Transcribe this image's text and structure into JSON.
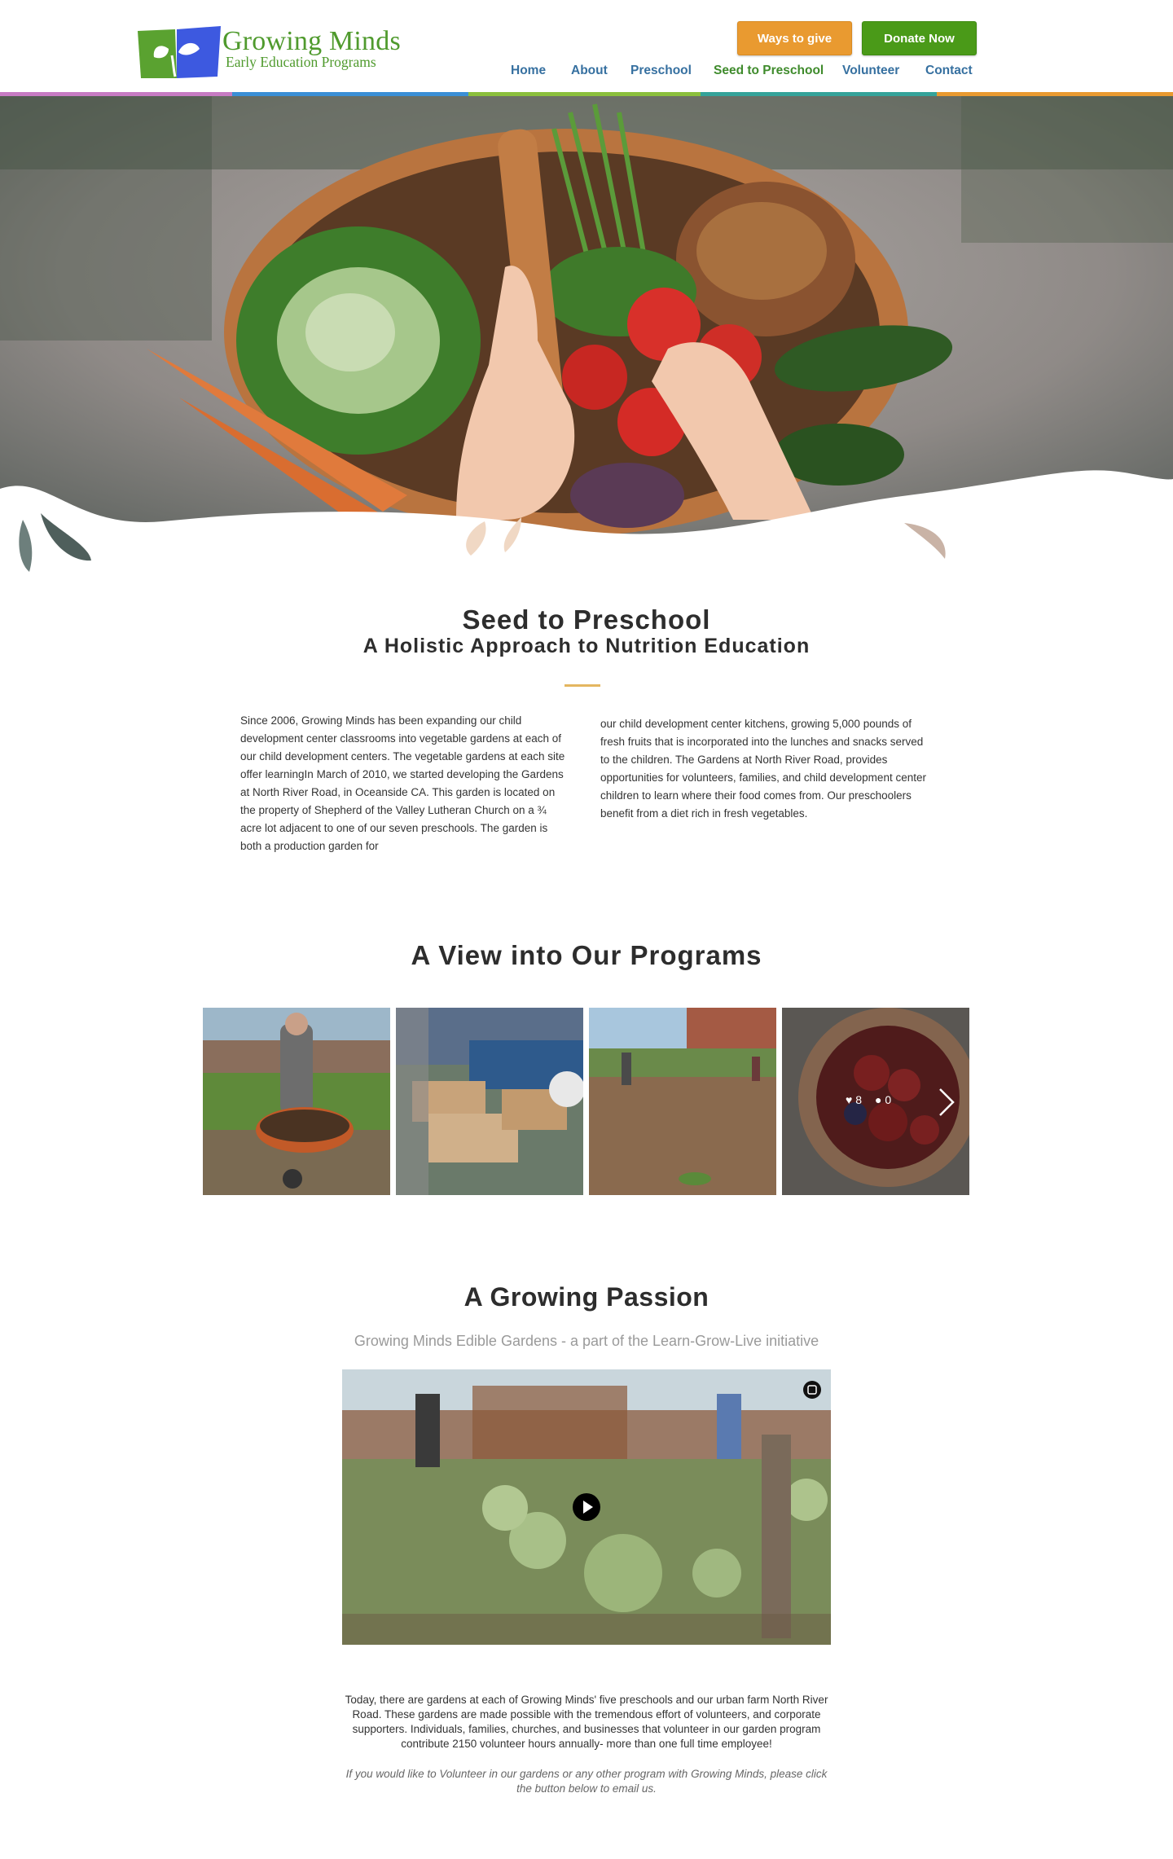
{
  "brand": {
    "title": "Growing Minds",
    "subtitle": "Early Education Programs",
    "color_green": "#4f9a2d",
    "color_blue": "#3d59e0",
    "logo_icon": "leaf-book-logo"
  },
  "header": {
    "give_label": "Ways to give",
    "donate_label": "Donate Now",
    "give_color": "#e99a30",
    "donate_color": "#4a9a18",
    "nav": {
      "home": "Home",
      "about": "About",
      "preschool": "Preschool",
      "seed": "Seed to Preschool",
      "volunteer": "Volunteer",
      "contact": "Contact"
    },
    "nav_color": "#3670a0",
    "nav_active_color": "#3f8b2c",
    "stripe_colors": [
      "#c77bc3",
      "#3a8fd6",
      "#8bbf3c",
      "#35a39a",
      "#e99a30"
    ]
  },
  "hero": {
    "image": "basket-of-vegetables-and-bread"
  },
  "seed": {
    "title": "Seed to Preschool",
    "subtitle": "A Holistic Approach to Nutrition Education",
    "col_left": "Since 2006, Growing Minds has been expanding our child development center classrooms into vegetable gardens at each of our child development centers. The vegetable gardens at each site offer learningIn March of 2010, we started developing the Gardens at North River Road, in Oceanside CA. This garden is located on the property of Shepherd of the Valley Lutheran Church on a ¾ acre lot adjacent to one of our seven preschools. The garden is both a production garden for",
    "col_right": "our child development center kitchens, growing 5,000 pounds of fresh fruits that is incorporated into the lunches and snacks served to the children. The Gardens at North River Road, provides opportunities for volunteers, families, and child development center children to learn where their food comes from. Our preschoolers benefit from a diet rich in fresh vegetables."
  },
  "programs": {
    "title": "A View into Our Programs",
    "likes": "8",
    "comments": "0",
    "photos": [
      "man-with-wheelbarrow",
      "raised-garden-beds",
      "tilled-garden-plot",
      "berry-tart"
    ]
  },
  "passion": {
    "title": "A Growing Passion",
    "subtitle": "Growing Minds Edible Gardens - a part of the Learn-Grow-Live initiative",
    "video_thumbnail": "artichoke-garden",
    "body": "Today, there are gardens at each of Growing Minds' five preschools and our urban farm North River Road. These gardens are made possible with the tremendous effort of volunteers, and corporate supporters. Individuals, families, churches, and businesses that volunteer in our garden program contribute 2150 volunteer hours annually- more than one full time employee!",
    "note": "If you would like to Volunteer in our gardens or any other program with Growing Minds, please click the button below to email us."
  }
}
